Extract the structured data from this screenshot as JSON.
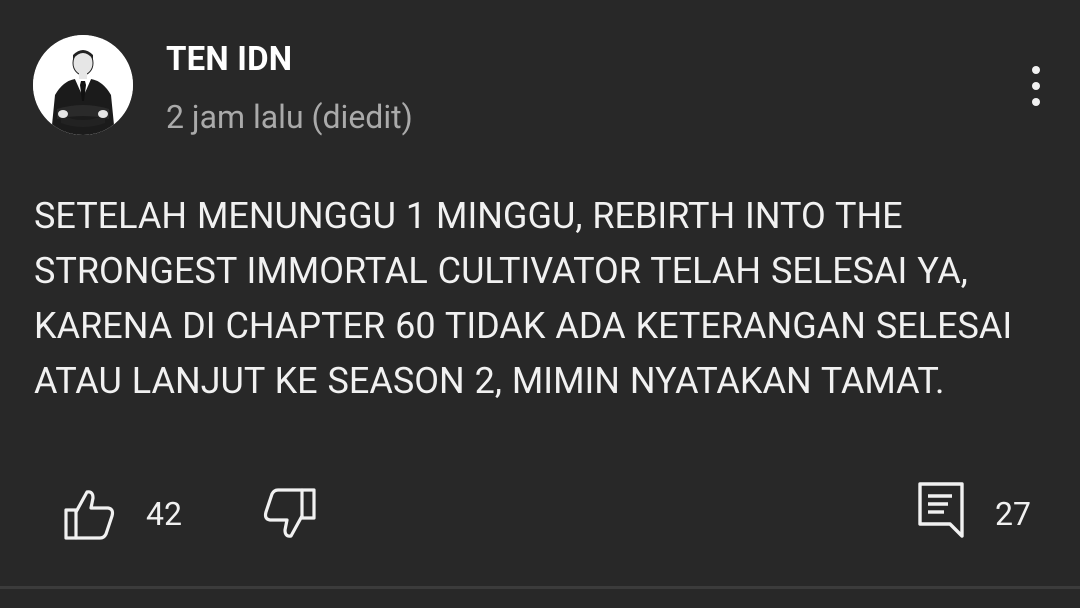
{
  "comment": {
    "author": "TEN IDN",
    "timestamp": "2 jam lalu (diedit)",
    "text": "SETELAH MENUNGGU 1 MINGGU, REBIRTH INTO THE STRONGEST IMMORTAL CULTIVATOR TELAH SELESAI YA, KARENA DI CHAPTER 60 TIDAK ADA KETERANGAN SELESAI ATAU LANJUT KE SEASON 2, MIMIN NYATAKAN TAMAT.",
    "like_count": "42",
    "reply_count": "27"
  },
  "icons": {
    "avatar": "avatar-suit-man",
    "more": "more-vertical-icon",
    "like": "thumbs-up-icon",
    "dislike": "thumbs-down-icon",
    "reply": "comment-reply-icon"
  },
  "colors": {
    "background": "#282828",
    "text_primary": "#f1f1f1",
    "text_secondary": "#aaaaaa",
    "divider": "#3b3b3b"
  }
}
